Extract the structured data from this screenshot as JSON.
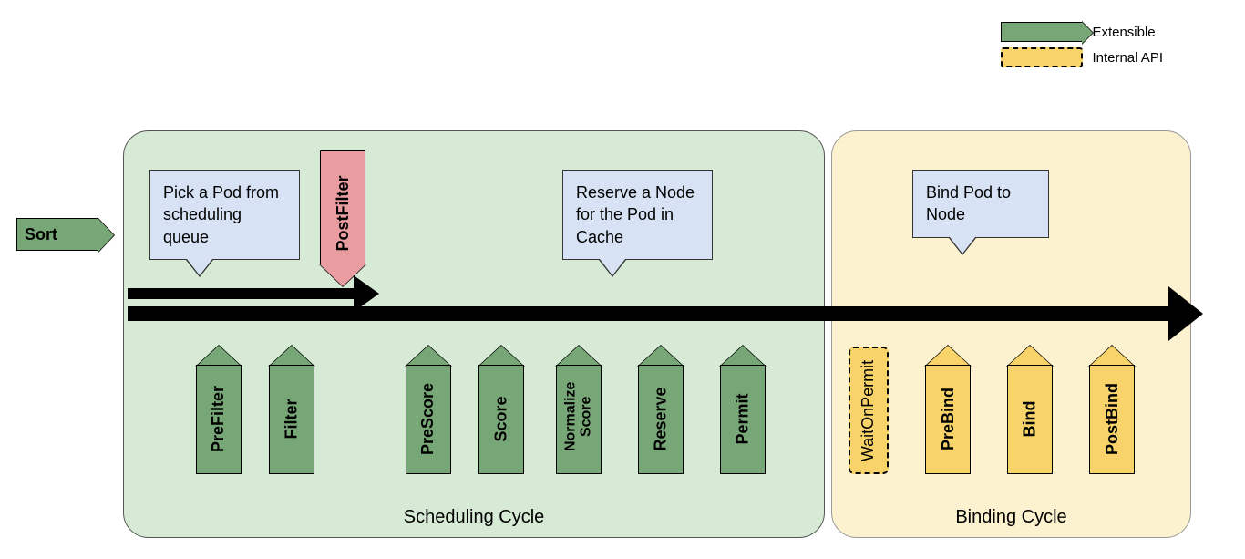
{
  "legend": {
    "extensible": "Extensible",
    "internal": "Internal API"
  },
  "sort": "Sort",
  "panels": {
    "scheduling": "Scheduling Cycle",
    "binding": "Binding Cycle"
  },
  "callouts": {
    "pick": "Pick a Pod from scheduling queue",
    "reserve": "Reserve a Node for the Pod in Cache",
    "bind": "Bind Pod to Node"
  },
  "stages": {
    "prefilter": "PreFilter",
    "filter": "Filter",
    "postfilter": "PostFilter",
    "prescore": "PreScore",
    "score": "Score",
    "normalize": "Normalize\nScore",
    "reserve": "Reserve",
    "permit": "Permit",
    "waitonpermit": "WaitOnPermit",
    "prebind": "PreBind",
    "bind": "Bind",
    "postbind": "PostBind"
  }
}
